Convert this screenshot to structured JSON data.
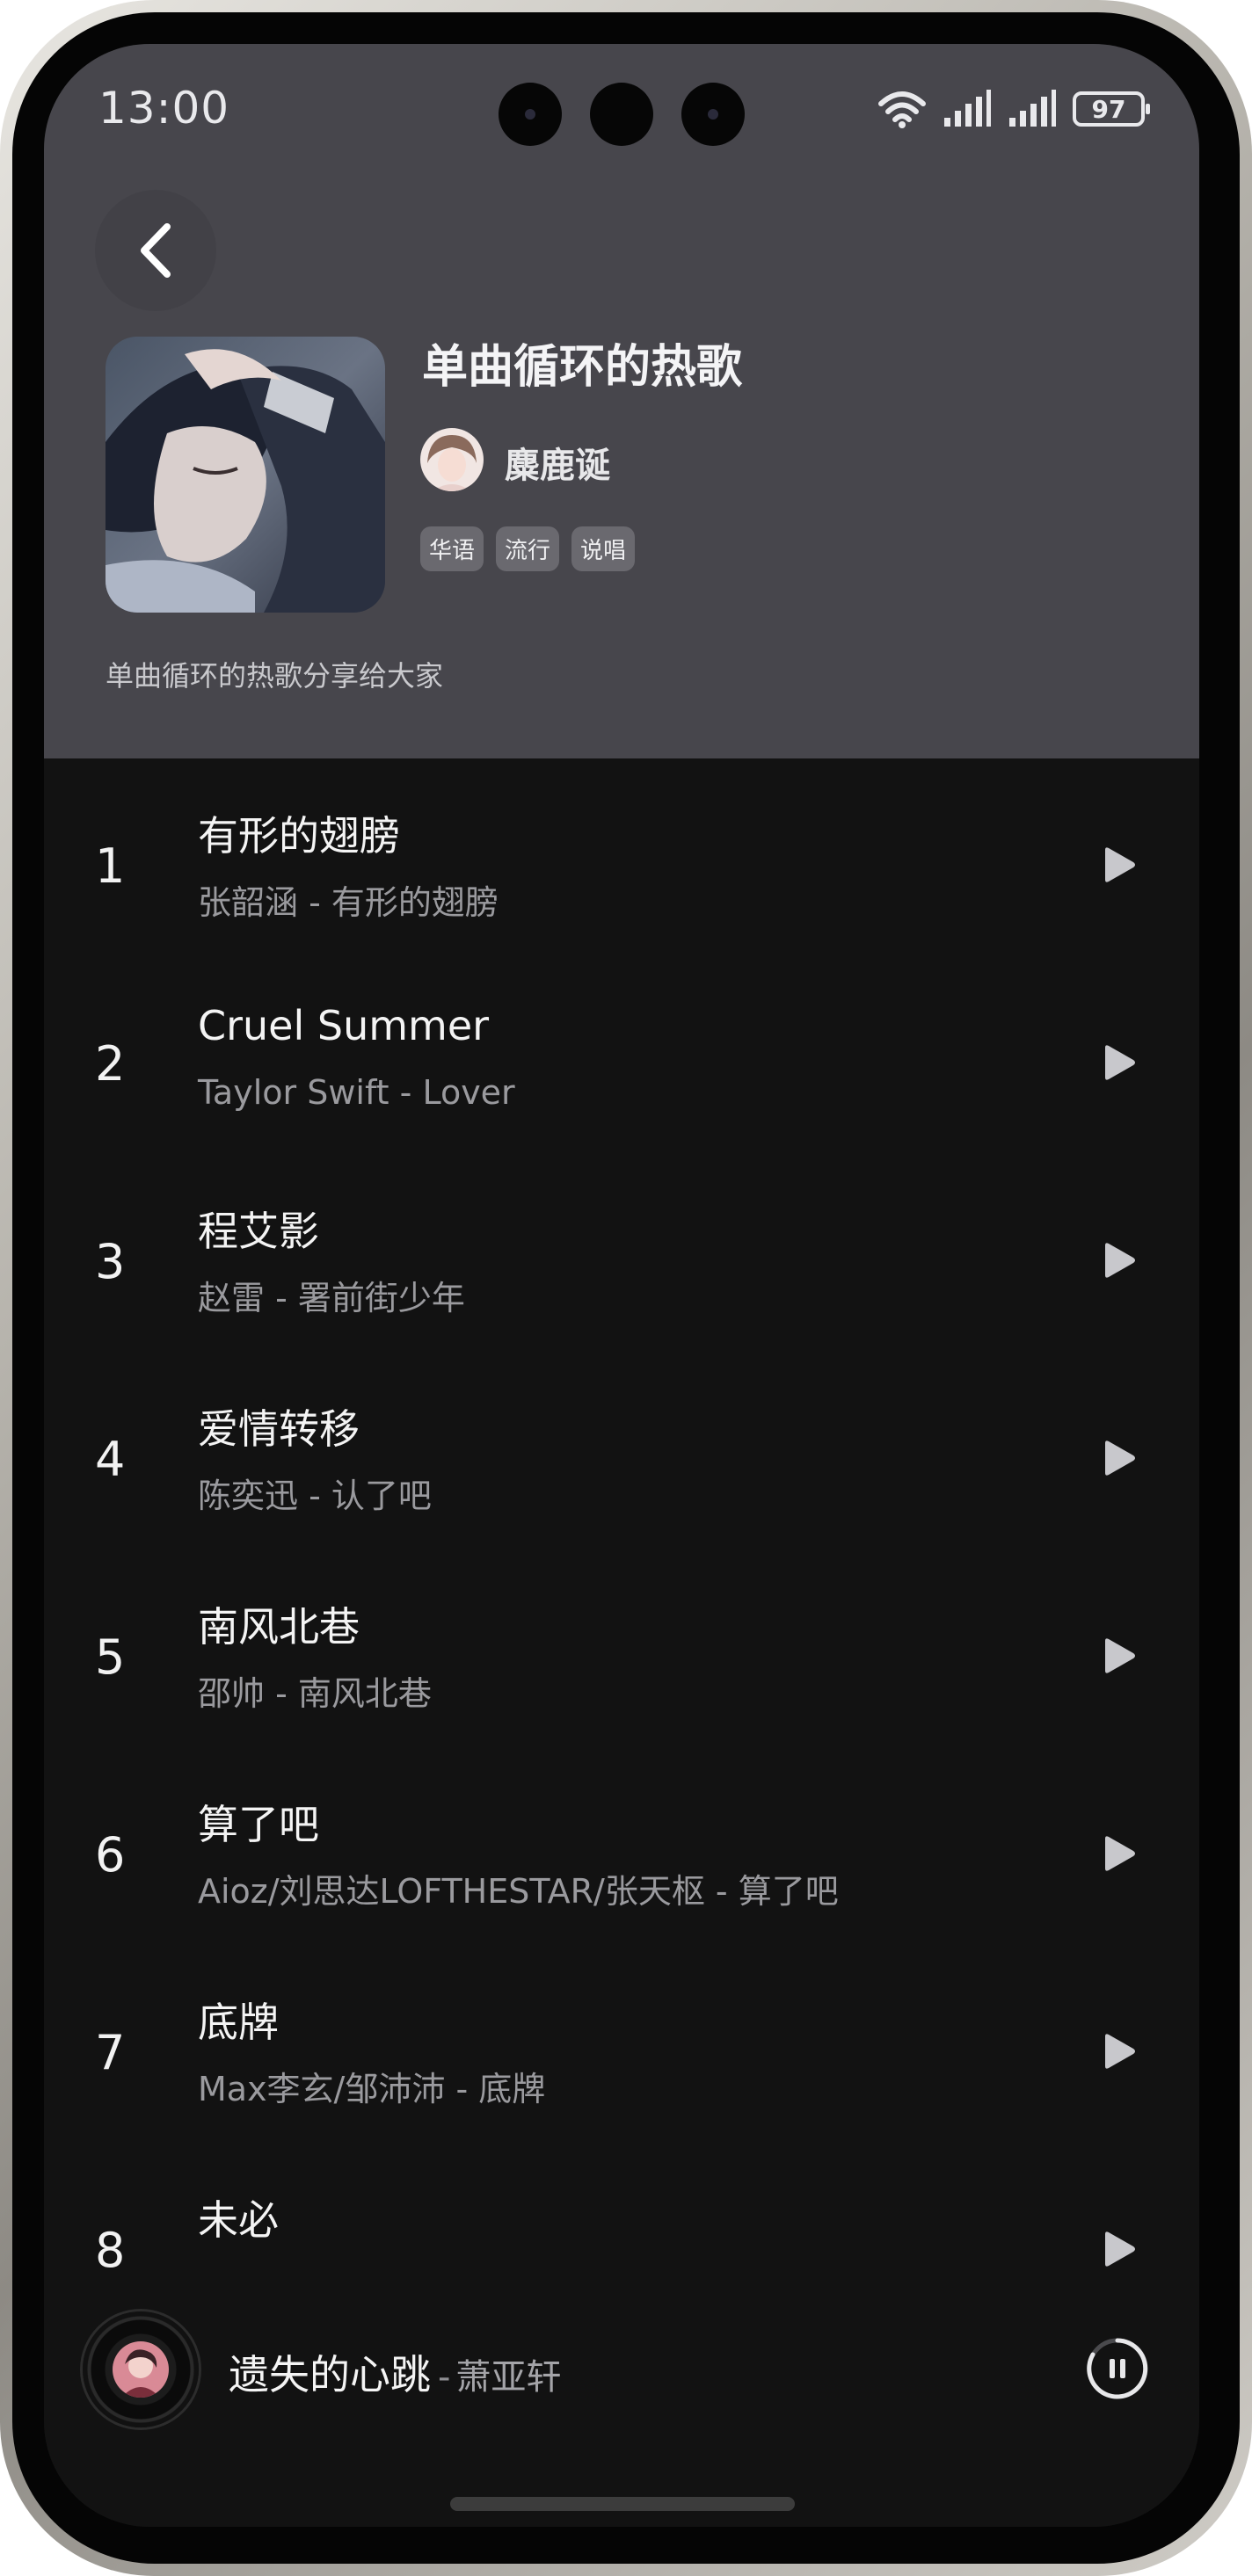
{
  "status_bar": {
    "time": "13:00",
    "battery": "97",
    "icons": [
      "wifi-icon",
      "signal-icon",
      "signal-icon",
      "battery-icon"
    ]
  },
  "header": {
    "back_icon": "chevron-left-icon",
    "title": "单曲循环的热歌",
    "creator": "麋鹿诞",
    "tags": [
      "华语",
      "流行",
      "说唱"
    ],
    "description": "单曲循环的热歌分享给大家"
  },
  "tracks": [
    {
      "num": "1",
      "title": "有形的翅膀",
      "subtitle": "张韶涵 - 有形的翅膀"
    },
    {
      "num": "2",
      "title": "Cruel Summer",
      "subtitle": "Taylor Swift - Lover"
    },
    {
      "num": "3",
      "title": "程艾影",
      "subtitle": "赵雷 - 署前街少年"
    },
    {
      "num": "4",
      "title": "爱情转移",
      "subtitle": "陈奕迅 - 认了吧"
    },
    {
      "num": "5",
      "title": "南风北巷",
      "subtitle": "邵帅 - 南风北巷"
    },
    {
      "num": "6",
      "title": "算了吧",
      "subtitle": "Aioz/刘思达LOFTHESTAR/张天枢 - 算了吧"
    },
    {
      "num": "7",
      "title": "底牌",
      "subtitle": "Max李玄/邹沛沛 - 底牌"
    },
    {
      "num": "8",
      "title": "未必",
      "subtitle": ""
    }
  ],
  "now_playing": {
    "title": "遗失的心跳",
    "separator": "-",
    "artist": "萧亚轩",
    "control_icon": "pause-icon"
  },
  "colors": {
    "header_bg": "#47464c",
    "list_bg": "#121212",
    "title_text": "#f4f4f4",
    "subtitle_text": "#9a9a9e"
  }
}
